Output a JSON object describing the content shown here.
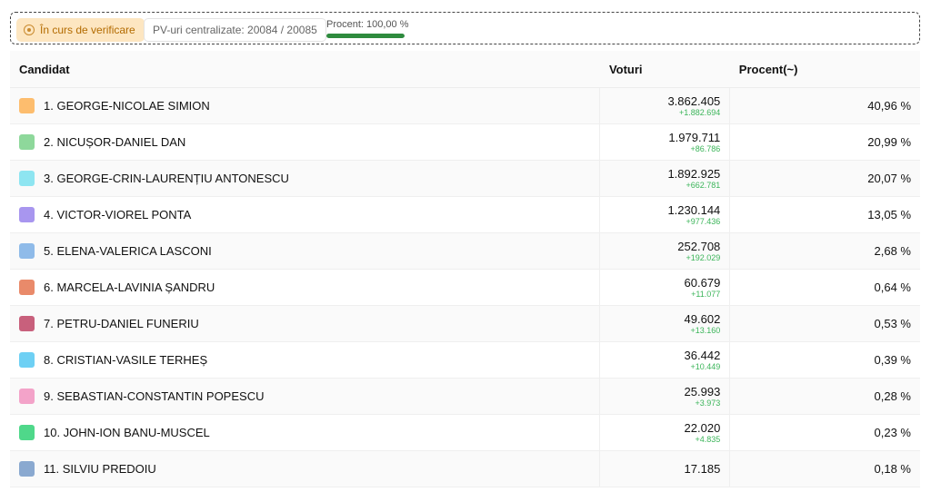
{
  "status": {
    "badge_label": "În curs de verificare",
    "pv_label": "PV-uri centralizate: 20084 / 20085",
    "progress_label": "Procent: 100,00 %",
    "progress_fraction": 1.0
  },
  "table": {
    "headers": {
      "candidate": "Candidat",
      "votes": "Voturi",
      "percent": "Procent(~)"
    },
    "rows": [
      {
        "name": "1. GEORGE-NICOLAE SIMION",
        "votes": "3.862.405",
        "delta": "+1.882.694",
        "percent": "40,96 %",
        "color": "#fdbd6e"
      },
      {
        "name": "2. NICUȘOR-DANIEL DAN",
        "votes": "1.979.711",
        "delta": "+86.786",
        "percent": "20,99 %",
        "color": "#8ed89b"
      },
      {
        "name": "3. GEORGE-CRIN-LAURENȚIU ANTONESCU",
        "votes": "1.892.925",
        "delta": "+662.781",
        "percent": "20,07 %",
        "color": "#8ee5f1"
      },
      {
        "name": "4. VICTOR-VIOREL PONTA",
        "votes": "1.230.144",
        "delta": "+977.436",
        "percent": "13,05 %",
        "color": "#a896ef"
      },
      {
        "name": "5. ELENA-VALERICA LASCONI",
        "votes": "252.708",
        "delta": "+192.029",
        "percent": "2,68 %",
        "color": "#8fbbe9"
      },
      {
        "name": "6. MARCELA-LAVINIA ȘANDRU",
        "votes": "60.679",
        "delta": "+11.077",
        "percent": "0,64 %",
        "color": "#e98a6a"
      },
      {
        "name": "7. PETRU-DANIEL FUNERIU",
        "votes": "49.602",
        "delta": "+13.160",
        "percent": "0,53 %",
        "color": "#c8607c"
      },
      {
        "name": "8. CRISTIAN-VASILE TERHEȘ",
        "votes": "36.442",
        "delta": "+10.449",
        "percent": "0,39 %",
        "color": "#6ed0f4"
      },
      {
        "name": "9. SEBASTIAN-CONSTANTIN POPESCU",
        "votes": "25.993",
        "delta": "+3.973",
        "percent": "0,28 %",
        "color": "#f3a3c9"
      },
      {
        "name": "10. JOHN-ION BANU-MUSCEL",
        "votes": "22.020",
        "delta": "+4.835",
        "percent": "0,23 %",
        "color": "#4fd88a"
      },
      {
        "name": "11. SILVIU PREDOIU",
        "votes": "17.185",
        "delta": "",
        "percent": "0,18 %",
        "color": "#8aa9d0"
      }
    ]
  }
}
